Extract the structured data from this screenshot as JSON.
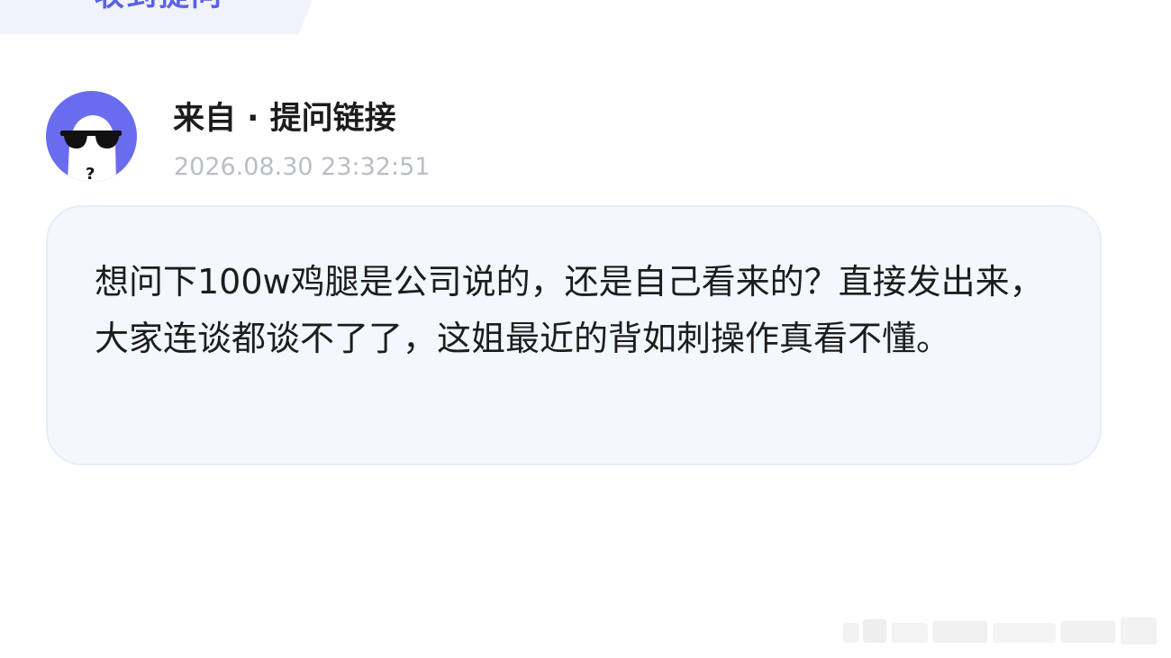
{
  "header": {
    "tab_label": "收到提问"
  },
  "question": {
    "sender": "来自 · 提问链接",
    "timestamp": "2026.08.30 23:32:51",
    "body": "想问下100w鸡腿是公司说的，还是自己看来的？直接发出来，大家连谈都谈不了了，这姐最近的背如刺操作真看不懂。"
  },
  "avatar": {
    "icon": "anonymous-sunglasses-icon",
    "background_color": "#6a6cf0",
    "glyph": "?"
  },
  "colors": {
    "accent": "#5a62e6",
    "bubble_bg": "#f3f7fe",
    "timestamp": "#b9bdc6"
  }
}
